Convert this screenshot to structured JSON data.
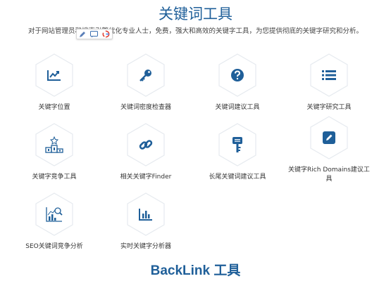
{
  "header": {
    "title": "关键词工具",
    "subtitle": "对于网站管理员和搜索引擎优化专业人士，免费，强大和高效的关键字工具，为您提供彻底的关键字研究和分析。"
  },
  "tools": [
    {
      "label": "关键字位置",
      "icon": "trending-chart-icon"
    },
    {
      "label": "关键词密度检查器",
      "icon": "key-icon"
    },
    {
      "label": "关键词建议工具",
      "icon": "question-icon"
    },
    {
      "label": "关键字研究工具",
      "icon": "list-icon"
    },
    {
      "label": "关键字竞争工具",
      "icon": "podium-icon"
    },
    {
      "label": "相关关键字Finder",
      "icon": "link-icon"
    },
    {
      "label": "长尾关键词建议工具",
      "icon": "long-key-icon"
    },
    {
      "label": "关键字Rich Domains建议工具",
      "icon": "edit-icon"
    },
    {
      "label": "SEO关键词竞争分析",
      "icon": "analytics-icon"
    },
    {
      "label": "实时关键字分析器",
      "icon": "bar-chart-icon"
    }
  ],
  "section2": {
    "title": "BackLink 工具"
  },
  "colors": {
    "accent": "#1f5f99",
    "hex_border": "#e4e9ef"
  }
}
